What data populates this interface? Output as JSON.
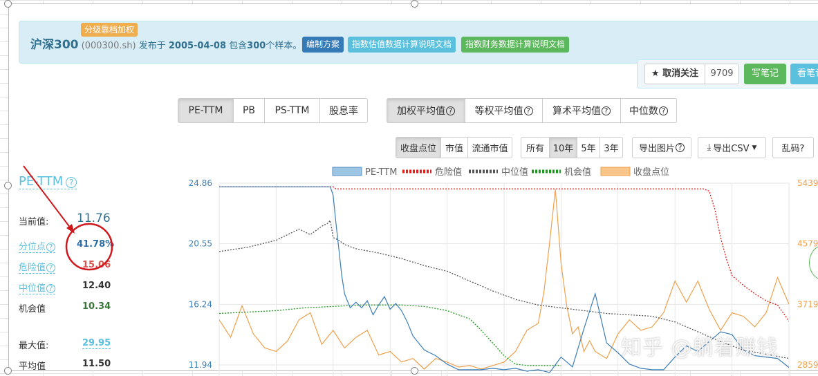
{
  "header": {
    "badge": "分级靠档加权",
    "index_name": "沪深300",
    "index_code": "(000300.sh)",
    "published_prefix": "发布于",
    "published_date": "2005-04-08",
    "contains_prefix": "包含",
    "sample_count": "300",
    "contains_suffix": "个样本。",
    "buttons": [
      "编制方案",
      "指数估值数据计算说明文档",
      "指数财务数据计算说明文档"
    ]
  },
  "follow": {
    "unfollow_label": "取消关注",
    "count": "9709",
    "write_note": "写笔记",
    "view_note": "看笔记"
  },
  "metric_tabs": [
    {
      "label": "PE-TTM",
      "active": true
    },
    {
      "label": "PB",
      "active": false
    },
    {
      "label": "PS-TTM",
      "active": false
    },
    {
      "label": "股息率",
      "active": false
    }
  ],
  "average_tabs": [
    {
      "label": "加权平均值",
      "active": true
    },
    {
      "label": "等权平均值",
      "active": false
    },
    {
      "label": "算术平均值",
      "active": false
    },
    {
      "label": "中位数",
      "active": false
    }
  ],
  "price_tabs": [
    {
      "label": "收盘点位",
      "active": true
    },
    {
      "label": "市值",
      "active": false
    },
    {
      "label": "流通市值",
      "active": false
    }
  ],
  "period_tabs": [
    {
      "label": "所有",
      "active": false
    },
    {
      "label": "10年",
      "active": true
    },
    {
      "label": "5年",
      "active": false
    },
    {
      "label": "3年",
      "active": false
    }
  ],
  "actions": {
    "export_image": "导出图片",
    "export_csv": "导出CSV",
    "garbled": "乱码?"
  },
  "stats": {
    "title": "PE-TTM",
    "current_label": "当前值:",
    "current_value": "11.76",
    "percentile_label": "分位点",
    "percentile_value": "41.78%",
    "danger_label": "危险值",
    "danger_value": "15.06",
    "median_label": "中位值",
    "median_value": "12.40",
    "chance_label": "机会值",
    "chance_value": "10.34",
    "max_label": "最大值:",
    "max_value": "29.95",
    "avg_label": "平均值",
    "avg_value": "11.50"
  },
  "watermark": "知乎 @躺着赚钱",
  "colors": {
    "pe": "#3b7db6",
    "danger": "#e0201a",
    "median": "#555555",
    "chance": "#1a9a1a",
    "price": "#f0a04b",
    "annotation": "#d0181c"
  },
  "chart_data": {
    "type": "line",
    "legend": [
      {
        "name": "PE-TTM",
        "style": "box",
        "color": "#9ec4e4"
      },
      {
        "name": "危险值",
        "style": "dotted",
        "color": "#e0201a"
      },
      {
        "name": "中位值",
        "style": "dotted",
        "color": "#555555"
      },
      {
        "name": "机会值",
        "style": "dotted",
        "color": "#1a9a1a"
      },
      {
        "name": "收盘点位",
        "style": "box",
        "color": "#f8c58a"
      }
    ],
    "legend_position": "top",
    "y_left": {
      "ticks": [
        "24.86",
        "20.55",
        "16.24",
        "11.94"
      ],
      "range": [
        11.94,
        24.86
      ]
    },
    "y_right": {
      "ticks": [
        "5439",
        "4579",
        "3719",
        "2859"
      ],
      "range": [
        2859,
        5439
      ]
    },
    "grid": true,
    "series": [
      {
        "name": "PE-TTM",
        "axis": "left",
        "style": "solid",
        "x": [
          0,
          8,
          10,
          12,
          14,
          16,
          18,
          19.5,
          20,
          20.5,
          21,
          21.5,
          22,
          23,
          24,
          25,
          26,
          27,
          28,
          29,
          30,
          31,
          32,
          33,
          34,
          36,
          38,
          40,
          42,
          44,
          46,
          48,
          50,
          52,
          54,
          56,
          58,
          60,
          62,
          64,
          66,
          68,
          70,
          72,
          74,
          76,
          78,
          80,
          82,
          84,
          86,
          88,
          90,
          92,
          94,
          96,
          98,
          100
        ],
        "y": [
          24.6,
          24.6,
          24.6,
          24.6,
          24.6,
          24.6,
          24.6,
          24.6,
          24.0,
          22.0,
          20.2,
          18.3,
          17.0,
          16.0,
          16.4,
          16.0,
          16.5,
          15.5,
          16.2,
          16.8,
          15.9,
          16.3,
          15.8,
          15.0,
          14.0,
          13.0,
          12.6,
          12.0,
          11.6,
          11.6,
          11.6,
          11.7,
          11.6,
          11.7,
          11.5,
          11.6,
          11.4,
          12.5,
          11.8,
          14.5,
          17.0,
          13.5,
          12.8,
          12.0,
          11.7,
          11.6,
          11.6,
          12.5,
          13.3,
          12.9,
          13.6,
          14.3,
          14.1,
          13.0,
          12.6,
          12.5,
          12.4,
          11.76
        ]
      },
      {
        "name": "危险值",
        "axis": "left",
        "style": "dotted",
        "x": [
          0,
          20,
          20.5,
          40,
          60,
          70,
          80,
          85,
          86,
          87,
          88,
          89,
          90,
          92,
          94,
          96,
          98,
          100
        ],
        "y": [
          24.6,
          24.6,
          24.45,
          24.45,
          24.45,
          24.45,
          24.45,
          24.45,
          24.3,
          23.0,
          21.0,
          19.5,
          18.3,
          17.6,
          17.0,
          16.5,
          16.2,
          15.06
        ]
      },
      {
        "name": "中位值",
        "axis": "left",
        "style": "dotted",
        "x": [
          0,
          5,
          10,
          14,
          16,
          18,
          19,
          19.5,
          20,
          21,
          22,
          24,
          28,
          32,
          36,
          40,
          44,
          48,
          52,
          56,
          60,
          64,
          68,
          72,
          76,
          80,
          84,
          88,
          92,
          96,
          100
        ],
        "y": [
          20.0,
          20.3,
          20.8,
          21.6,
          21.2,
          21.8,
          22.0,
          22.2,
          21.0,
          20.8,
          20.5,
          20.2,
          19.9,
          19.5,
          19.0,
          18.6,
          17.9,
          17.2,
          16.6,
          16.2,
          16.0,
          15.8,
          15.6,
          15.5,
          15.4,
          15.0,
          14.3,
          13.6,
          13.0,
          12.7,
          12.4
        ]
      },
      {
        "name": "机会值",
        "axis": "left",
        "style": "dotted",
        "x": [
          0,
          5,
          10,
          15,
          20,
          25,
          28,
          32,
          36,
          40,
          44,
          46,
          48,
          50,
          52,
          54,
          56,
          58,
          60
        ],
        "y": [
          15.6,
          15.7,
          15.8,
          16.0,
          16.1,
          16.2,
          16.2,
          16.2,
          16.1,
          15.8,
          15.2,
          14.4,
          13.5,
          12.6,
          12.0,
          11.9,
          11.9,
          11.9,
          11.9
        ]
      },
      {
        "name": "收盘点位",
        "axis": "right",
        "style": "solid",
        "x": [
          0,
          2,
          4,
          6,
          8,
          10,
          12,
          14,
          16,
          18,
          20,
          22,
          24,
          26,
          28,
          30,
          32,
          34,
          36,
          38,
          40,
          42,
          44,
          46,
          48,
          50,
          52,
          54,
          56,
          57,
          58,
          59,
          60,
          61,
          62,
          63,
          64,
          65,
          66,
          67,
          68,
          70,
          72,
          74,
          76,
          78,
          80,
          82,
          84,
          86,
          88,
          90,
          92,
          94,
          96,
          98,
          100
        ],
        "y": [
          3500,
          3250,
          3700,
          3300,
          3100,
          3050,
          3200,
          3500,
          3600,
          3150,
          3350,
          3100,
          3250,
          3350,
          3000,
          3050,
          2900,
          2950,
          2800,
          2950,
          2900,
          2830,
          2850,
          2800,
          2850,
          2900,
          3050,
          3350,
          3450,
          3900,
          4600,
          5350,
          4300,
          3700,
          3300,
          3400,
          3050,
          3200,
          3050,
          3000,
          2950,
          3300,
          3500,
          3350,
          3400,
          3600,
          4050,
          3750,
          4050,
          3650,
          3350,
          3600,
          3550,
          3400,
          3600,
          4100,
          3720
        ]
      }
    ]
  }
}
